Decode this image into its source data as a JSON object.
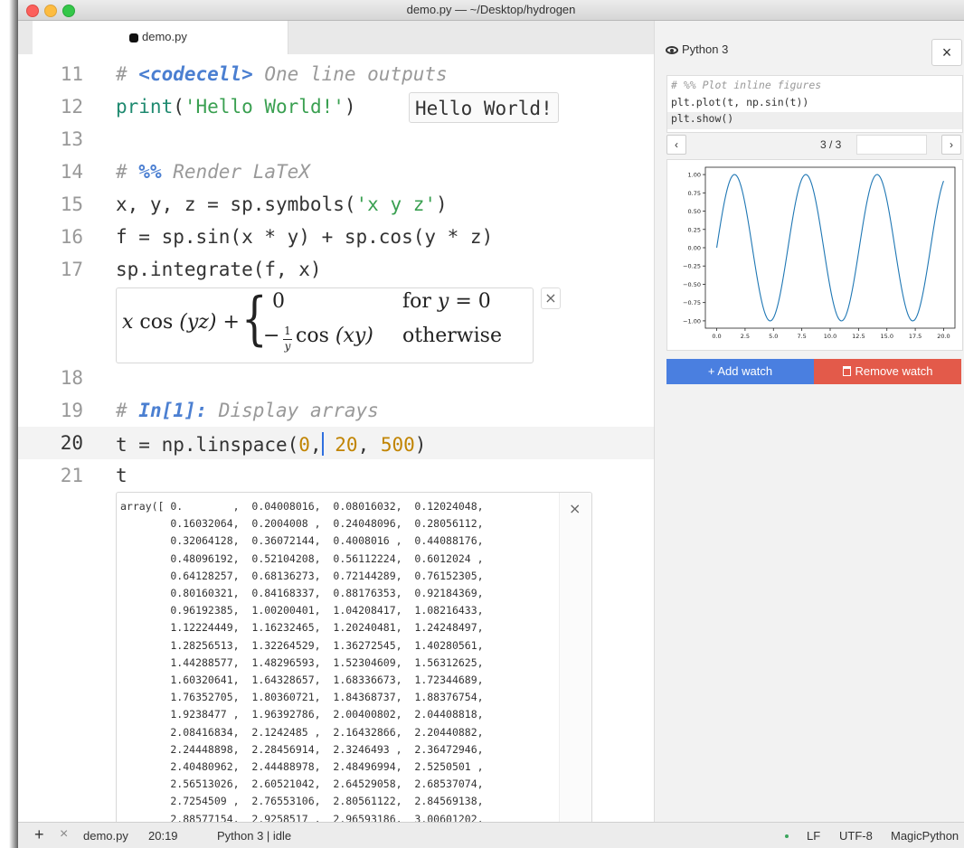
{
  "window": {
    "title": "demo.py — ~/Desktop/hydrogen"
  },
  "tab": {
    "label": "demo.py",
    "icon": "python-icon"
  },
  "editor": {
    "lines": [
      {
        "n": "11",
        "active": false
      },
      {
        "n": "12",
        "active": false
      },
      {
        "n": "13",
        "active": false
      },
      {
        "n": "14",
        "active": false
      },
      {
        "n": "15",
        "active": false
      },
      {
        "n": "16",
        "active": false
      },
      {
        "n": "17",
        "active": false
      },
      {
        "n": "18",
        "active": false
      },
      {
        "n": "19",
        "active": false
      },
      {
        "n": "20",
        "active": true
      },
      {
        "n": "21",
        "active": false
      }
    ],
    "code": {
      "l11_hash": "# ",
      "l11_kw": "<codecell>",
      "l11_rest": " One line outputs",
      "l12_fn": "print",
      "l12_open": "(",
      "l12_str": "'Hello World!'",
      "l12_close": ")",
      "l14_hash": "# ",
      "l14_kw": "%%",
      "l14_rest": " Render LaTeX",
      "l15_pre": "x, y, z = sp.symbols(",
      "l15_str": "'x y z'",
      "l15_post": ")",
      "l16": "f = sp.sin(x * y) + sp.cos(y * z)",
      "l17": "sp.integrate(f, x)",
      "l19_hash": "# ",
      "l19_kw": "In[1]:",
      "l19_rest": " Display arrays",
      "l20_pre": "t = np.linspace(",
      "l20_n1": "0",
      "l20_comma": ",",
      "l20_sp": " ",
      "l20_n2": "20",
      "l20_c2": ", ",
      "l20_n3": "500",
      "l20_close": ")",
      "l21": "t"
    },
    "hello_output": "Hello World!",
    "latex": {
      "lhs_x": "x",
      "lhs_cos": " cos ",
      "lhs_arg": "(yz)",
      "lhs_plus": " +",
      "case1_expr": "0",
      "case1_cond_for": "for ",
      "case1_cond_y": "y",
      "case1_cond_eq": " = 0",
      "case2_minus": "−",
      "frac_num": "1",
      "frac_den": "y",
      "case2_cos": "cos ",
      "case2_arg": "(xy)",
      "case2_cond": "otherwise",
      "close": "×"
    },
    "array_output": "array([ 0.        ,  0.04008016,  0.08016032,  0.12024048,\n        0.16032064,  0.2004008 ,  0.24048096,  0.28056112,\n        0.32064128,  0.36072144,  0.4008016 ,  0.44088176,\n        0.48096192,  0.52104208,  0.56112224,  0.6012024 ,\n        0.64128257,  0.68136273,  0.72144289,  0.76152305,\n        0.80160321,  0.84168337,  0.88176353,  0.92184369,\n        0.96192385,  1.00200401,  1.04208417,  1.08216433,\n        1.12224449,  1.16232465,  1.20240481,  1.24248497,\n        1.28256513,  1.32264529,  1.36272545,  1.40280561,\n        1.44288577,  1.48296593,  1.52304609,  1.56312625,\n        1.60320641,  1.64328657,  1.68336673,  1.72344689,\n        1.76352705,  1.80360721,  1.84368737,  1.88376754,\n        1.9238477 ,  1.96392786,  2.00400802,  2.04408818,\n        2.08416834,  2.1242485 ,  2.16432866,  2.20440882,\n        2.24448898,  2.28456914,  2.3246493 ,  2.36472946,\n        2.40480962,  2.44488978,  2.48496994,  2.5250501 ,\n        2.56513026,  2.60521042,  2.64529058,  2.68537074,\n        2.7254509 ,  2.76553106,  2.80561122,  2.84569138,\n        2.88577154,  2.9258517 ,  2.96593186,  3.00601202,",
    "array_close": "×"
  },
  "watch": {
    "kernel": "Python 3",
    "close": "×",
    "code_l1": "# %% Plot inline figures",
    "code_l2": "plt.plot(t, np.sin(t))",
    "code_l3": "plt.show()",
    "prev": "‹",
    "next": "›",
    "page": "3 / 3",
    "add_label": "+ Add watch",
    "remove_label": "Remove watch"
  },
  "chart_data": {
    "type": "line",
    "x_ticks": [
      0.0,
      2.5,
      5.0,
      7.5,
      10.0,
      12.5,
      15.0,
      17.5,
      20.0
    ],
    "x_tick_labels": [
      "0.0",
      "2.5",
      "5.0",
      "7.5",
      "10.0",
      "12.5",
      "15.0",
      "17.5",
      "20.0"
    ],
    "y_ticks": [
      1.0,
      0.75,
      0.5,
      0.25,
      0.0,
      -0.25,
      -0.5,
      -0.75,
      -1.0
    ],
    "y_tick_labels": [
      "1.00",
      "0.75",
      "0.50",
      "0.25",
      "0.00",
      "−0.25",
      "−0.50",
      "−0.75",
      "−1.00"
    ],
    "xlim": [
      -1.0,
      21.0
    ],
    "ylim": [
      -1.1,
      1.1
    ],
    "series": [
      {
        "function": "sin(t)",
        "x_range": [
          0,
          20
        ],
        "samples": 500,
        "color": "#1f77b4"
      }
    ],
    "grid": false,
    "title": "",
    "xlabel": "",
    "ylabel": ""
  },
  "statusbar": {
    "add": "+",
    "close": "×",
    "file": "demo.py",
    "cursor": "20:19",
    "kernel_status": "Python 3 | idle",
    "line_ending": "LF",
    "encoding": "UTF-8",
    "grammar": "MagicPython"
  },
  "colors": {
    "accent": "#4a7fe0",
    "danger": "#e35a4a",
    "plot_line": "#1f77b4"
  }
}
